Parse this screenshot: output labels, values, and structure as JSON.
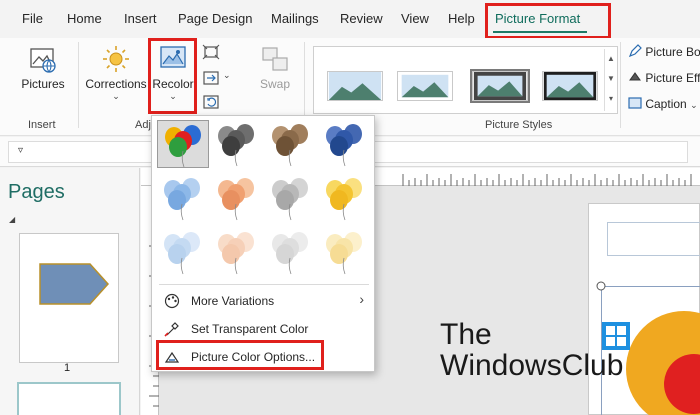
{
  "menu": {
    "items": [
      "File",
      "Home",
      "Insert",
      "Page Design",
      "Mailings",
      "Review",
      "View",
      "Help",
      "Picture Format"
    ],
    "active": "Picture Format"
  },
  "ribbon": {
    "insert_group": {
      "pictures_label": "Pictures",
      "group_label": "Insert"
    },
    "adjust_group": {
      "corrections_label": "Corrections",
      "recolor_label": "Recolor",
      "group_label_visible": "Adj"
    },
    "swap_label": "Swap",
    "picture_styles_label": "Picture Styles",
    "right_commands": [
      "Picture Bo",
      "Picture Eff",
      "Caption"
    ]
  },
  "pages_panel": {
    "title": "Pages",
    "page_number": "1"
  },
  "recolor_menu": {
    "swatch_rows": [
      [
        "multicolor",
        "gray-dark",
        "brown",
        "blue-dark"
      ],
      [
        "light-blue",
        "orange",
        "gray",
        "yellow"
      ],
      [
        "pale-blue",
        "pale-orange",
        "pale-gray",
        "pale-yellow"
      ]
    ],
    "selected_swatch": "multicolor",
    "items": {
      "more_variations": "More Variations",
      "set_transparent": "Set Transparent Color",
      "picture_color_options": "Picture Color Options..."
    }
  },
  "watermark": {
    "line1": "The",
    "line2": "WindowsClub"
  },
  "colors": {
    "accent_green": "#1f7a67",
    "highlight_red": "#e0201c",
    "pages_title": "#1f6d64"
  }
}
